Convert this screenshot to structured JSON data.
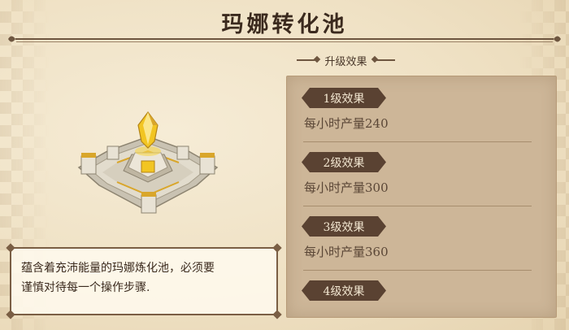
{
  "title": "玛娜转化池",
  "section_label": "升级效果",
  "effects": [
    {
      "label": "1级效果",
      "desc": "每小时产量240"
    },
    {
      "label": "2级效果",
      "desc": "每小时产量300"
    },
    {
      "label": "3级效果",
      "desc": "每小时产量360"
    },
    {
      "label": "4级效果",
      "desc": ""
    }
  ],
  "description": {
    "line1": "蕴含着充沛能量的玛娜炼化池，必须要",
    "line2": "谨慎对待每一个操作步骤."
  },
  "colors": {
    "tag_bg": "#5a4232",
    "effects_bg": "#cdb698",
    "crystal": "#f2c522"
  },
  "icons": {
    "building": "mana-pool-building-icon"
  }
}
